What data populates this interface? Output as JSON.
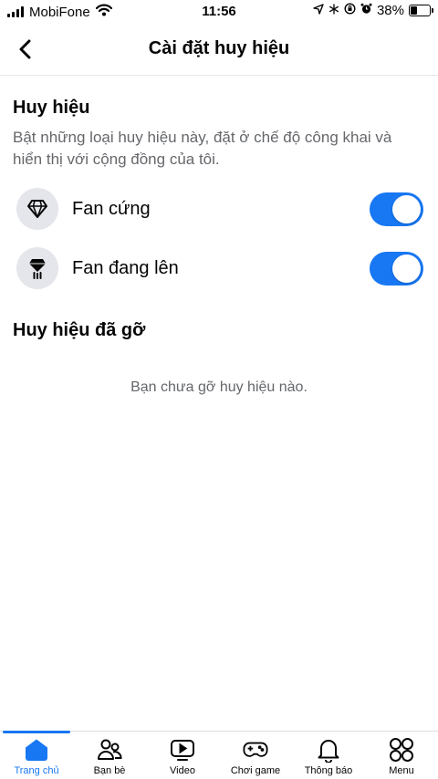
{
  "status_bar": {
    "carrier": "MobiFone",
    "time": "11:56",
    "battery": "38%",
    "battery_level": 0.38,
    "icons": [
      "signal-icon",
      "wifi-icon",
      "location-icon",
      "snowflake-icon",
      "screen-lock-icon",
      "alarm-icon",
      "battery-icon"
    ]
  },
  "header": {
    "title": "Cài đặt huy hiệu",
    "back_icon": "chevron-left-icon"
  },
  "badges_section": {
    "title": "Huy hiệu",
    "description": "Bật những loại huy hiệu này, đặt ở chế độ công khai và hiển thị với cộng đồng của tôi.",
    "items": [
      {
        "label": "Fan cứng",
        "icon": "diamond-icon",
        "enabled": true
      },
      {
        "label": "Fan đang lên",
        "icon": "rising-diamond-icon",
        "enabled": true
      }
    ]
  },
  "removed_section": {
    "title": "Huy hiệu đã gỡ",
    "empty_text": "Bạn chưa gỡ huy hiệu nào."
  },
  "bottom_nav": {
    "items": [
      {
        "label": "Trang chủ",
        "icon": "home-icon",
        "active": true
      },
      {
        "label": "Bạn bè",
        "icon": "friends-icon",
        "active": false
      },
      {
        "label": "Video",
        "icon": "video-icon",
        "active": false
      },
      {
        "label": "Chơi game",
        "icon": "gamepad-icon",
        "active": false
      },
      {
        "label": "Thông báo",
        "icon": "bell-icon",
        "active": false
      },
      {
        "label": "Menu",
        "icon": "menu-grid-icon",
        "active": false
      }
    ]
  },
  "colors": {
    "accent": "#1877f2",
    "text": "#050505",
    "secondary_text": "#65676b",
    "icon_background": "#e4e6eb"
  }
}
